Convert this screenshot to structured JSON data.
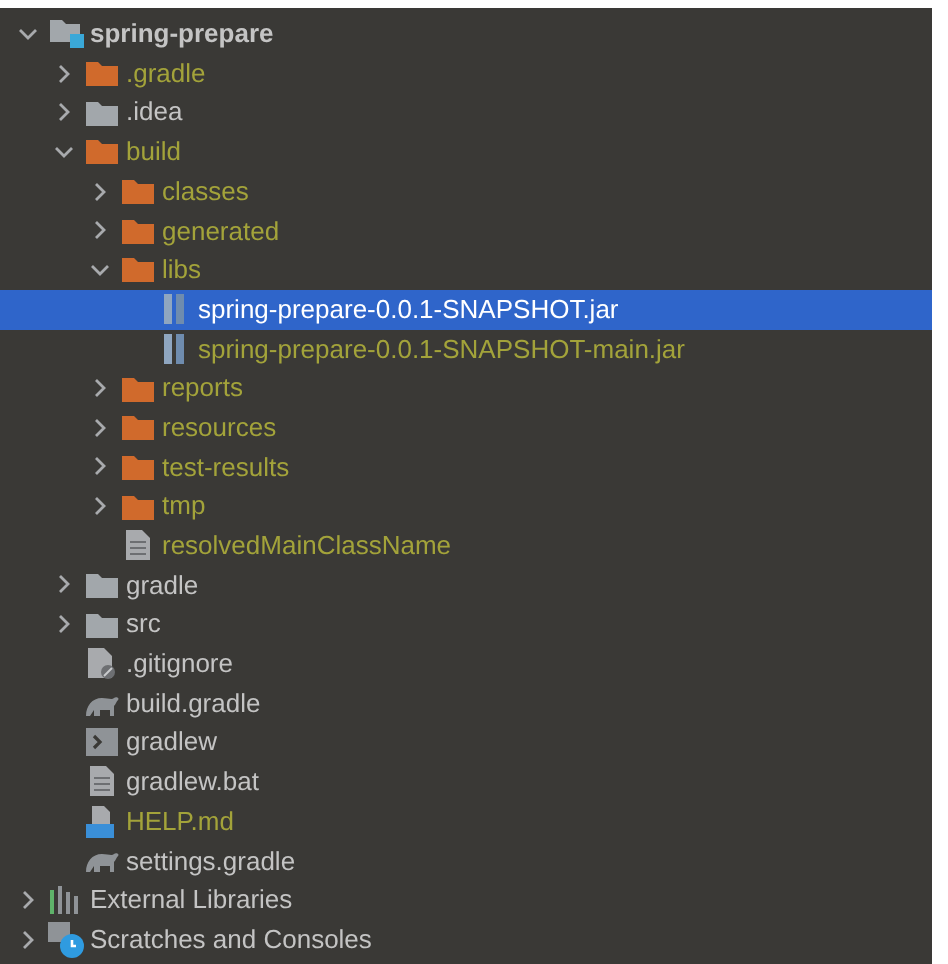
{
  "tree": [
    {
      "label": "spring-prepare",
      "kind": "module",
      "expanded": true,
      "excluded": false,
      "selected": false,
      "children": [
        {
          "label": ".gradle",
          "kind": "folder",
          "expanded": false,
          "excluded": true,
          "selected": false
        },
        {
          "label": ".idea",
          "kind": "folder",
          "expanded": false,
          "excluded": false,
          "selected": false
        },
        {
          "label": "build",
          "kind": "folder",
          "expanded": true,
          "excluded": true,
          "selected": false,
          "children": [
            {
              "label": "classes",
              "kind": "folder",
              "expanded": false,
              "excluded": true,
              "selected": false
            },
            {
              "label": "generated",
              "kind": "folder",
              "expanded": false,
              "excluded": true,
              "selected": false
            },
            {
              "label": "libs",
              "kind": "folder",
              "expanded": true,
              "excluded": true,
              "selected": false,
              "children": [
                {
                  "label": "spring-prepare-0.0.1-SNAPSHOT.jar",
                  "kind": "jar",
                  "selected": true
                },
                {
                  "label": "spring-prepare-0.0.1-SNAPSHOT-main.jar",
                  "kind": "jar",
                  "excluded": true,
                  "selected": false
                }
              ]
            },
            {
              "label": "reports",
              "kind": "folder",
              "expanded": false,
              "excluded": true,
              "selected": false
            },
            {
              "label": "resources",
              "kind": "folder",
              "expanded": false,
              "excluded": true,
              "selected": false
            },
            {
              "label": "test-results",
              "kind": "folder",
              "expanded": false,
              "excluded": true,
              "selected": false
            },
            {
              "label": "tmp",
              "kind": "folder",
              "expanded": false,
              "excluded": true,
              "selected": false
            },
            {
              "label": "resolvedMainClassName",
              "kind": "file",
              "excluded": true,
              "selected": false
            }
          ]
        },
        {
          "label": "gradle",
          "kind": "folder",
          "expanded": false,
          "excluded": false,
          "selected": false
        },
        {
          "label": "src",
          "kind": "folder",
          "expanded": false,
          "excluded": false,
          "selected": false
        },
        {
          "label": ".gitignore",
          "kind": "ignore",
          "excluded": false,
          "selected": false
        },
        {
          "label": "build.gradle",
          "kind": "gradle",
          "excluded": false,
          "selected": false
        },
        {
          "label": "gradlew",
          "kind": "script",
          "excluded": false,
          "selected": false
        },
        {
          "label": "gradlew.bat",
          "kind": "file",
          "excluded": false,
          "selected": false
        },
        {
          "label": "HELP.md",
          "kind": "markdown",
          "excluded": true,
          "selected": false
        },
        {
          "label": "settings.gradle",
          "kind": "gradle",
          "excluded": false,
          "selected": false
        }
      ]
    },
    {
      "label": "External Libraries",
      "kind": "libraries",
      "expanded": false,
      "excluded": false,
      "selected": false
    },
    {
      "label": "Scratches and Consoles",
      "kind": "scratches",
      "expanded": false,
      "excluded": false,
      "selected": false
    }
  ]
}
